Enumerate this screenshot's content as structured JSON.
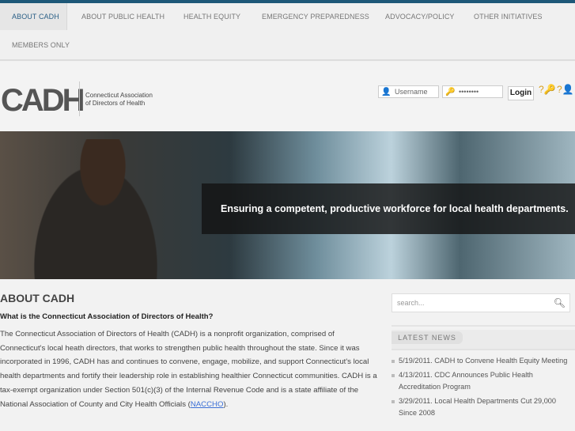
{
  "nav": {
    "items": [
      {
        "label": "ABOUT CADH"
      },
      {
        "label": "ABOUT PUBLIC HEALTH"
      },
      {
        "label": "HEALTH EQUITY"
      },
      {
        "label": "EMERGENCY PREPAREDNESS"
      },
      {
        "label": "ADVOCACY/POLICY"
      },
      {
        "label": "OTHER INITIATIVES"
      },
      {
        "label": "MEMBERS ONLY"
      }
    ]
  },
  "header": {
    "logo": "CADH",
    "logo_line1": "Connecticut Association",
    "logo_line2": "of Directors of Health",
    "username_placeholder": "Username",
    "password_value": "••••••••",
    "login_label": "Login"
  },
  "banner": {
    "caption": "Ensuring a competent, productive workforce for local health departments."
  },
  "main": {
    "title": "ABOUT CADH",
    "question": "What is the Connecticut Association of Directors of Health?",
    "paragraph": "The Connecticut Association of Directors of Health (CADH) is a nonprofit organization, comprised of Connecticut's local heath directors, that works to strengthen public health throughout the state.  Since it was incorporated in 1996, CADH has and continues to convene, engage, mobilize, and support Connecticut's local health departments and fortify their leadership role in establishing healthier Connecticut communities.  CADH is a tax-exempt organization under Section 501(c)(3) of the Internal Revenue Code and is a state affiliate of the National Association of County and City Health Officials (",
    "link": "NACCHO",
    "paragraph_end": ")."
  },
  "sidebar": {
    "search_placeholder": "search...",
    "news_title": "LATEST NEWS",
    "news": [
      "5/19/2011. CADH to Convene Health Equity Meeting",
      "4/13/2011. CDC Announces Public Health Accreditation Program",
      "3/29/2011. Local Health Departments Cut 29,000 Since 2008"
    ]
  }
}
